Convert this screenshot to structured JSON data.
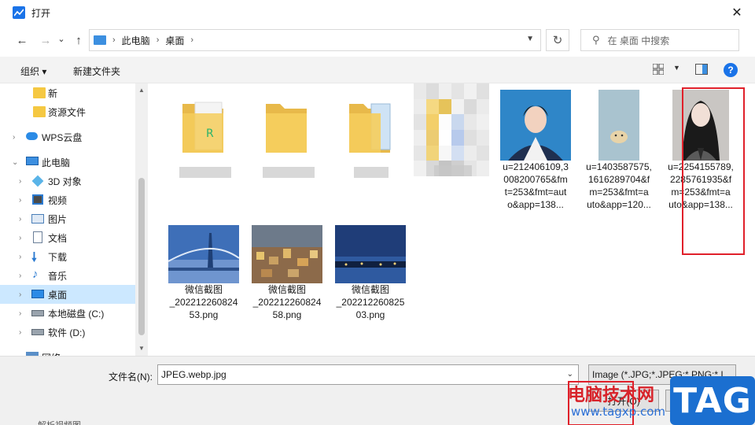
{
  "window": {
    "title": "打开",
    "close_glyph": "✕"
  },
  "nav": {
    "back": "←",
    "forward": "→",
    "recent": "⌄",
    "up": "↑",
    "breadcrumb": [
      "此电脑",
      "桌面"
    ],
    "separator": "›",
    "refresh": "↻",
    "search_placeholder": "在 桌面 中搜索"
  },
  "toolbar": {
    "organize": "组织 ▾",
    "new_folder": "新建文件夹",
    "help": "?"
  },
  "sidebar": {
    "items": [
      {
        "label": "新",
        "icon": "folder-icon"
      },
      {
        "label": "资源文件",
        "icon": "folder-icon"
      },
      {
        "label": "WPS云盘",
        "icon": "cloud-icon"
      },
      {
        "label": "此电脑",
        "icon": "computer-icon"
      },
      {
        "label": "3D 对象",
        "icon": "3d-objects-icon"
      },
      {
        "label": "视频",
        "icon": "video-icon"
      },
      {
        "label": "图片",
        "icon": "pictures-icon"
      },
      {
        "label": "文档",
        "icon": "documents-icon"
      },
      {
        "label": "下载",
        "icon": "downloads-icon"
      },
      {
        "label": "音乐",
        "icon": "music-icon"
      },
      {
        "label": "桌面",
        "icon": "desktop-icon",
        "selected": true
      },
      {
        "label": "本地磁盘 (C:)",
        "icon": "drive-icon"
      },
      {
        "label": "软件 (D:)",
        "icon": "drive-icon"
      },
      {
        "label": "网络",
        "icon": "network-icon"
      }
    ]
  },
  "files": {
    "row1": [
      {
        "type": "folder-blurred"
      },
      {
        "type": "folder-blurred"
      },
      {
        "type": "folder-blurred"
      },
      {
        "type": "blurred"
      },
      {
        "name": "u=212406109,3008200765&fmt=auto&app=138...",
        "lines": [
          "u=212406109,3",
          "008200765&fm",
          "t=253&fmt=aut",
          "o&app=138..."
        ]
      },
      {
        "name": "u=1403587575,1616289704&fm=253&fmt=auto&app=120...",
        "lines": [
          "u=1403587575,",
          "1616289704&f",
          "m=253&fmt=a",
          "uto&app=120..."
        ]
      },
      {
        "name": "u=2254155789,2285761935&fm=253&fmt=auto&app=138...",
        "lines": [
          "u=2254155789,",
          "2285761935&f",
          "m=253&fmt=a",
          "uto&app=138..."
        ]
      }
    ],
    "row2": [
      {
        "lines": [
          "微信截图",
          "_202212260824",
          "53.png"
        ]
      },
      {
        "lines": [
          "微信截图",
          "_202212260824",
          "58.png"
        ]
      },
      {
        "lines": [
          "微信截图",
          "_202212260825",
          "03.png"
        ]
      }
    ]
  },
  "bottom": {
    "filename_label": "文件名(N):",
    "filename_value": "JPEG.webp.jpg",
    "filetype_value": "Image (*.JPG;*.JPEG;*.PNG;*.I",
    "open_button": "打开(O)",
    "cancel_button": "取消",
    "peek_text": "解析视频图"
  },
  "watermark": {
    "text": "电脑技术网",
    "url": "www.tagxp.com",
    "tag": "TAG"
  },
  "colors": {
    "accent": "#1a73e8",
    "selected": "#cce8ff",
    "highlight": "#e0202a",
    "folder": "#f5c842"
  }
}
